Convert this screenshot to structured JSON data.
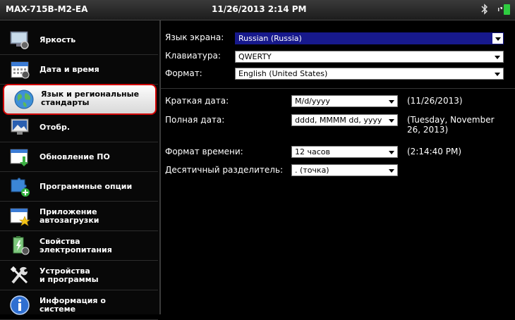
{
  "titlebar": {
    "device": "MAX-715B-M2-EA",
    "datetime": "11/26/2013 2:14 PM",
    "icons": [
      "bluetooth-icon",
      "battery-icon"
    ]
  },
  "sidebar": {
    "items": [
      {
        "label": "Яркость",
        "icon": "brightness-icon"
      },
      {
        "label": "Дата и время",
        "icon": "calendar-icon"
      },
      {
        "label": "Язык и региональные\nстандарты",
        "icon": "globe-icon"
      },
      {
        "label": "Отобр.",
        "icon": "display-icon"
      },
      {
        "label": "Обновление ПО",
        "icon": "software-update-icon"
      },
      {
        "label": "Программные опции",
        "icon": "puzzle-icon"
      },
      {
        "label": "Приложение\nавтозагрузки",
        "icon": "startup-app-icon"
      },
      {
        "label": "Свойства\nэлектропитания",
        "icon": "power-icon"
      },
      {
        "label": "Устройства\nи программы",
        "icon": "tools-icon"
      },
      {
        "label": "Информация о\nсистеме",
        "icon": "info-icon"
      }
    ],
    "selected_index": 2
  },
  "settings": {
    "display_language": {
      "label": "Язык экрана:",
      "value": "Russian (Russia)"
    },
    "keyboard": {
      "label": "Клавиатура:",
      "value": "QWERTY"
    },
    "format": {
      "label": "Формат:",
      "value": "English (United States)"
    },
    "short_date": {
      "label": "Краткая дата:",
      "value": "M/d/yyyy",
      "example": "(11/26/2013)"
    },
    "long_date": {
      "label": "Полная дата:",
      "value": "dddd, MMMM dd, yyyy",
      "example": "(Tuesday, November\n26, 2013)"
    },
    "time_format": {
      "label": "Формат времени:",
      "value": "12 часов",
      "example": "(2:14:40 PM)"
    },
    "decimal_separator": {
      "label": "Десятичный разделитель:",
      "value": ". (точка)"
    }
  },
  "colors": {
    "selection_border": "#d10000",
    "active_dropdown": "#17198c"
  }
}
